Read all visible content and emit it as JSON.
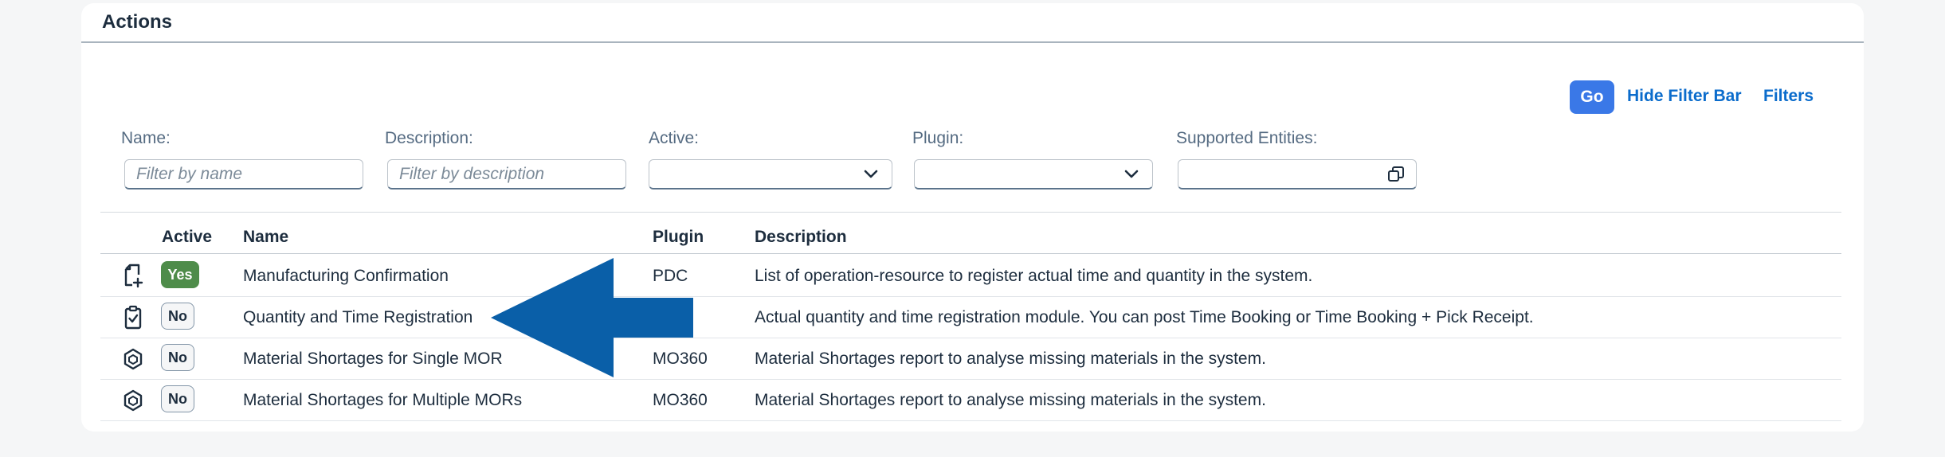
{
  "card": {
    "title": "Actions"
  },
  "filterbar": {
    "go_label": "Go",
    "hide_label": "Hide Filter Bar",
    "filters_label": "Filters",
    "name": {
      "label": "Name:",
      "placeholder": "Filter by name"
    },
    "description": {
      "label": "Description:",
      "placeholder": "Filter by description"
    },
    "active": {
      "label": "Active:",
      "value": ""
    },
    "plugin": {
      "label": "Plugin:",
      "value": ""
    },
    "entities": {
      "label": "Supported Entities:",
      "value": ""
    }
  },
  "table": {
    "headers": {
      "active": "Active",
      "name": "Name",
      "plugin": "Plugin",
      "description": "Description"
    },
    "rows": [
      {
        "icon": "document-add-icon",
        "active": "Yes",
        "name": "Manufacturing Confirmation",
        "plugin": "PDC",
        "description": "List of operation-resource to register actual time and quantity in the system."
      },
      {
        "icon": "clipboard-check-icon",
        "active": "No",
        "name": "Quantity and Time Registration",
        "plugin": "",
        "description": "Actual quantity and time registration module. You can post Time Booking or Time Booking + Pick Receipt."
      },
      {
        "icon": "material-hexagon-icon",
        "active": "No",
        "name": "Material Shortages for Single MOR",
        "plugin": "MO360",
        "description": "Material Shortages report to analyse missing materials in the system."
      },
      {
        "icon": "material-hexagon-icon",
        "active": "No",
        "name": "Material Shortages for Multiple MORs",
        "plugin": "MO360",
        "description": "Material Shortages report to analyse missing materials in the system."
      }
    ]
  },
  "annotation": {
    "icon": "pointer-arrow-icon",
    "color": "#0a5fa8"
  },
  "colors": {
    "accent": "#3a78e7",
    "link": "#0b6ccc",
    "positive": "#4e8c4a"
  }
}
